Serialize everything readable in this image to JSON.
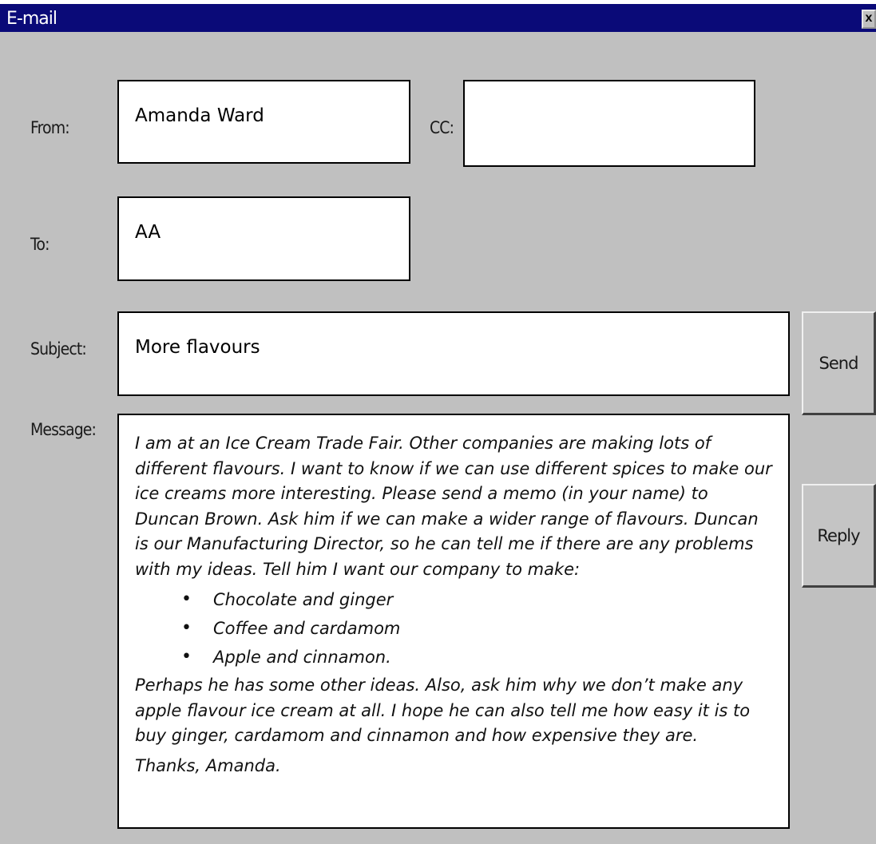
{
  "window": {
    "title": "E-mail",
    "close_label": "x"
  },
  "labels": {
    "from": "From:",
    "cc": "CC:",
    "to": "To:",
    "subject": "Subject:",
    "message": "Message:"
  },
  "fields": {
    "from": "Amanda Ward",
    "cc": "",
    "to": "AA",
    "subject": "More flavours"
  },
  "buttons": {
    "send": "Send",
    "reply": "Reply"
  },
  "message": {
    "intro": "I am at an Ice Cream Trade Fair.  Other companies are making lots of different flavours.  I want to know if we can use different spices to make our ice creams more interesting.  Please send a memo (in your name) to Duncan Brown.  Ask him if we can make a wider range of flavours.  Duncan is our Manufacturing Director, so he can tell me if there are any problems with my ideas.  Tell him I want our company to make:",
    "items": [
      "Chocolate and ginger",
      "Coffee and cardamom",
      "Apple and cinnamon."
    ],
    "outro": "Perhaps he has some other ideas.  Also, ask him why we don’t make any apple flavour ice cream at all.  I hope he can also tell me how easy it is to buy ginger, cardamom and cinnamon and how expensive they are.",
    "signoff": "Thanks, Amanda."
  }
}
